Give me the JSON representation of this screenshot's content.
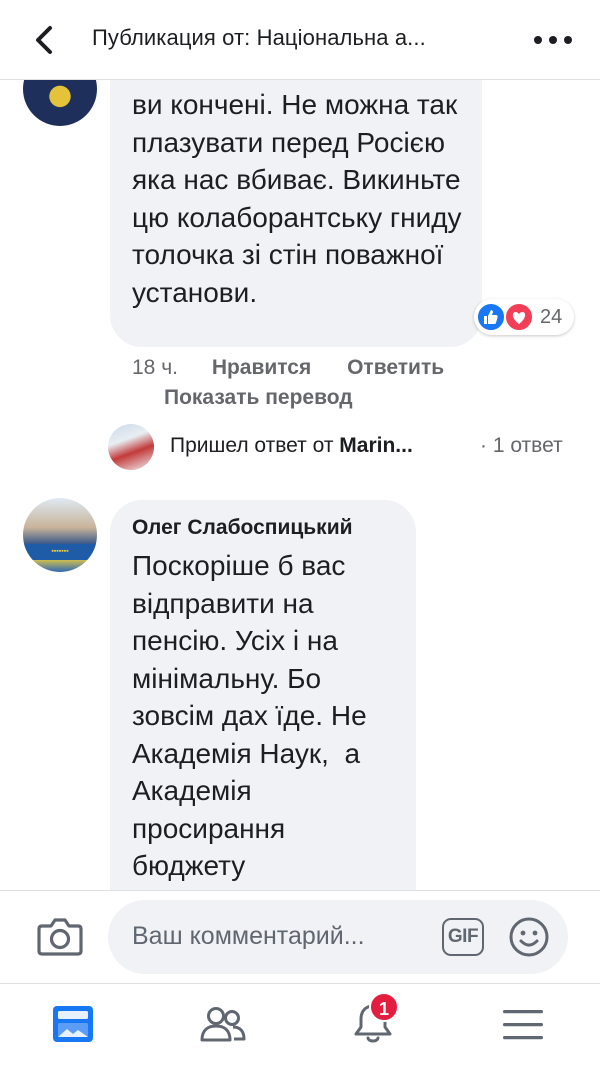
{
  "header": {
    "title": "Публикация от: Національна а...",
    "back_icon": "back-arrow-icon",
    "more_icon": "more-options-icon"
  },
  "comments": [
    {
      "text": "ви кончені. Не можна так плазувати перед Росією яка нас вбиває. Викиньте цю колаборантську гниду толочка зі стін поважної установи.",
      "reactions": {
        "icons": [
          "like-icon",
          "love-icon"
        ],
        "count": "24"
      },
      "time": "18 ч.",
      "like_label": "Нравится",
      "reply_label": "Ответить",
      "translate_label": "Показать перевод",
      "reply_summary": {
        "prefix": "Пришел ответ от ",
        "author": "Marin...",
        "count": "· 1 ответ"
      }
    },
    {
      "author": "Олег Слабоспицький",
      "text": "Поскоріше б вас\nвідправити на\nпенсію. Усіх і на\nмінімальну. Бо\nзовсім дах їде. Не\nАкадемія Наук,  а\nАкадемія\nпросирання\nбюджету"
    }
  ],
  "composer": {
    "placeholder": "Ваш комментарий...",
    "gif_label": "GIF",
    "camera_icon": "camera-icon",
    "emoji_icon": "emoji-icon"
  },
  "nav": {
    "items": [
      {
        "icon": "news-feed-icon",
        "active": true
      },
      {
        "icon": "friends-icon"
      },
      {
        "icon": "notifications-bell-icon",
        "badge": "1"
      },
      {
        "icon": "menu-icon"
      }
    ]
  },
  "colors": {
    "accent": "#1877f2",
    "love": "#f33e58",
    "badge": "#e41e3f",
    "bubble": "#f0f2f5",
    "muted": "#65676b"
  }
}
